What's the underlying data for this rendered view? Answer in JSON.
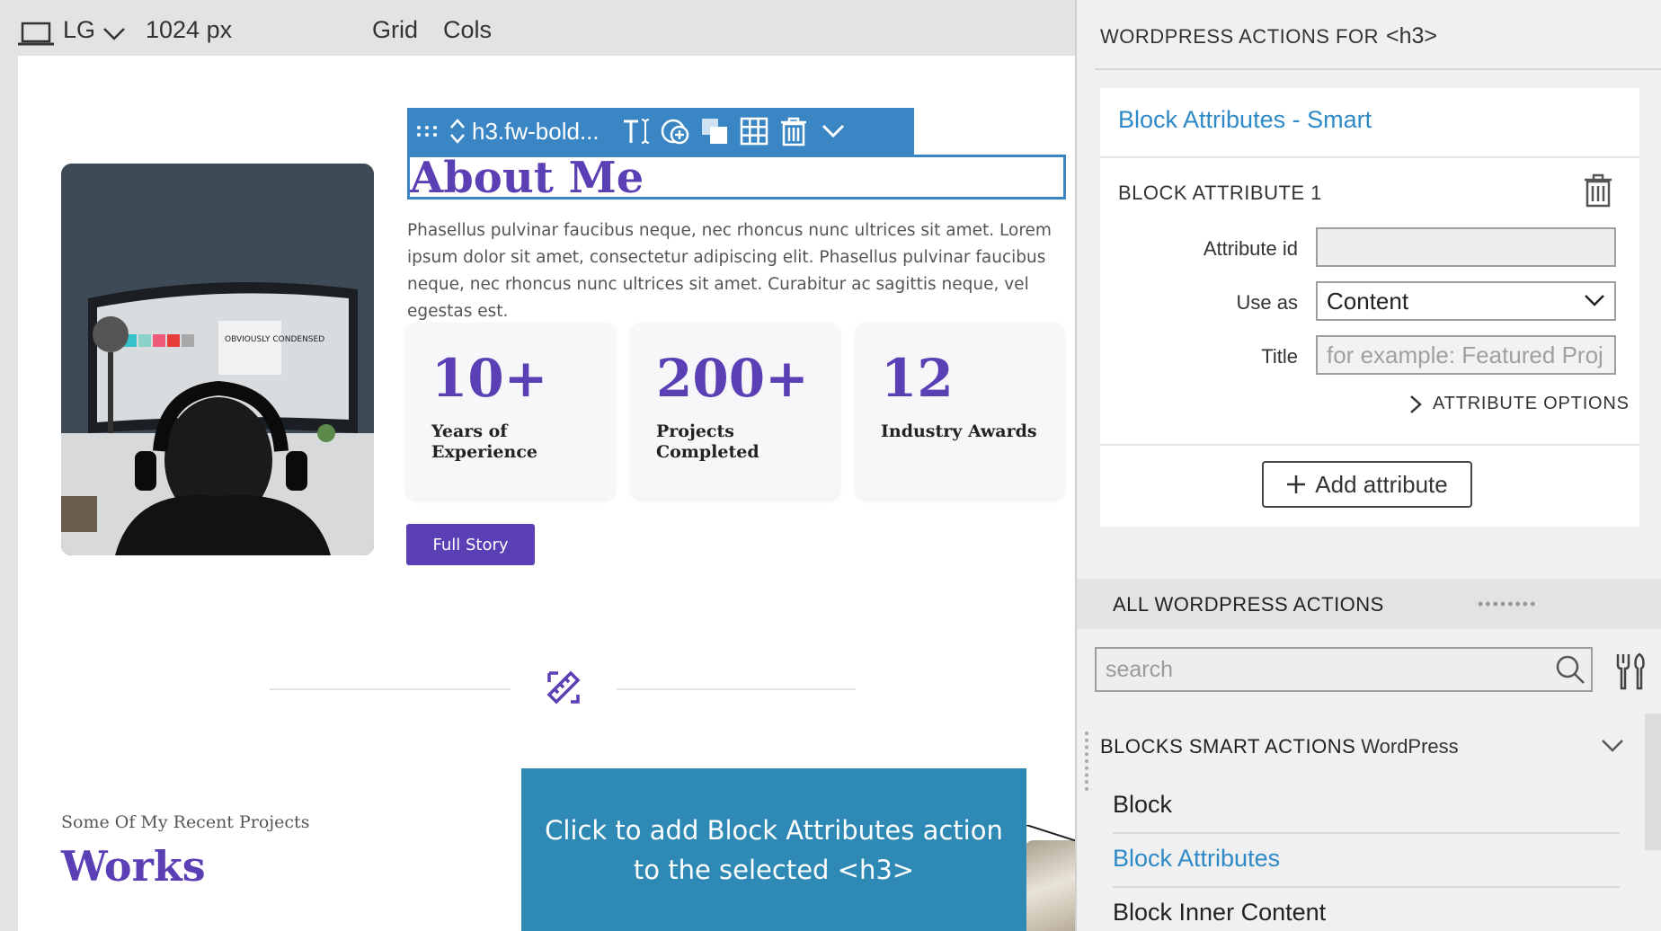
{
  "topbar": {
    "breakpoint": "LG",
    "width": "1024 px",
    "grid_label": "Grid",
    "cols_label": "Cols"
  },
  "block_toolbar": {
    "selector": "h3.fw-bold..."
  },
  "about": {
    "title": "About Me",
    "text": "Phasellus pulvinar faucibus neque, nec rhoncus nunc ultrices sit amet. Lorem ipsum dolor sit amet, consectetur adipiscing elit. Phasellus pulvinar faucibus neque, nec rhoncus nunc ultrices sit amet. Curabitur ac sagittis neque, vel egestas est.",
    "stats": [
      {
        "num": "10+",
        "label": "Years of Experience"
      },
      {
        "num": "200+",
        "label": "Projects Completed"
      },
      {
        "num": "12",
        "label": "Industry Awards"
      }
    ],
    "button": "Full Story",
    "photo_text": "OBVIOUSLY CONDENSED"
  },
  "works": {
    "subtitle": "Some Of My Recent Projects",
    "title": "Works"
  },
  "tooltip": {
    "line1": "Click to add Block Attributes action",
    "line2": "to the selected <h3>"
  },
  "panel": {
    "header": "WORDPRESS ACTIONS FOR",
    "header_tag": "<h3>",
    "card_title": "Block Attributes - Smart",
    "attr_title": "BLOCK ATTRIBUTE 1",
    "attr_id_label": "Attribute id",
    "attr_id_value": "",
    "use_as_label": "Use as",
    "use_as_value": "Content",
    "title_label": "Title",
    "title_placeholder": "for example: Featured Proj",
    "attr_options": "ATTRIBUTE OPTIONS",
    "add_attr": "Add attribute",
    "all_actions": "ALL WORDPRESS ACTIONS",
    "drag_dots": "••••••••",
    "search_placeholder": "search",
    "group_title": "BLOCKS SMART ACTIONS",
    "group_sub": "WordPress",
    "actions": [
      "Block",
      "Block Attributes",
      "Block Inner Content"
    ]
  },
  "colors": {
    "accent_purple": "#5b3fb5",
    "toolbar_blue": "#3a86c4",
    "tooltip_blue": "#2e89b4",
    "link_blue": "#2e89c7"
  }
}
